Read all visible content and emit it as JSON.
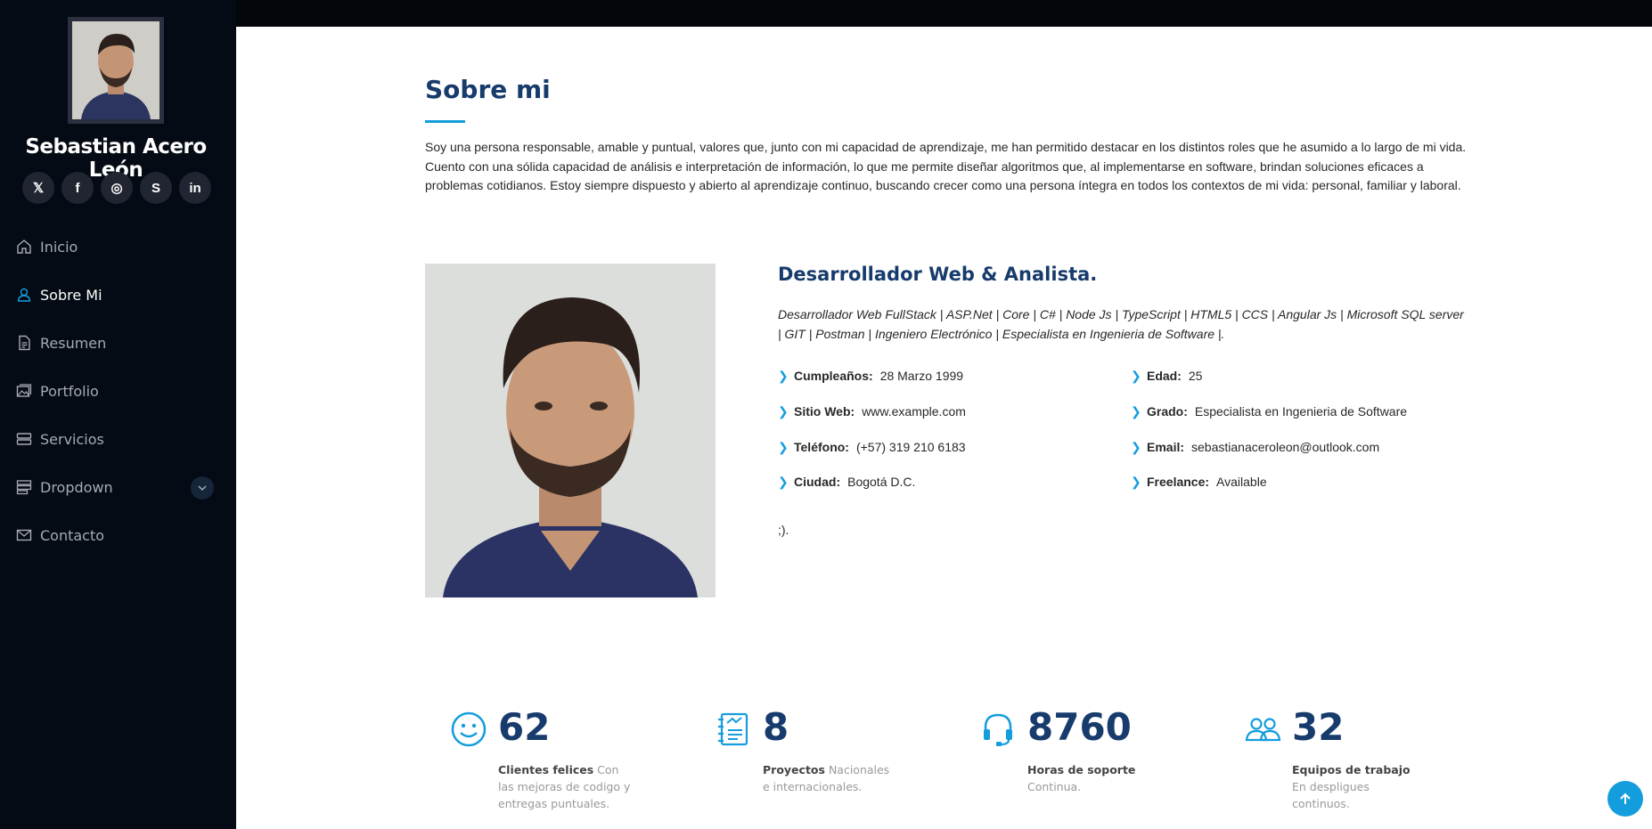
{
  "sidebar": {
    "name": "Sebastian Acero León",
    "social": [
      {
        "icon": "x-twitter-icon",
        "glyph": "𝕏"
      },
      {
        "icon": "facebook-icon",
        "glyph": "f"
      },
      {
        "icon": "instagram-icon",
        "glyph": "◎"
      },
      {
        "icon": "skype-icon",
        "glyph": "S"
      },
      {
        "icon": "linkedin-icon",
        "glyph": "in"
      }
    ],
    "nav": [
      {
        "label": "Inicio",
        "icon": "home-icon",
        "active": false
      },
      {
        "label": "Sobre Mi",
        "icon": "user-icon",
        "active": true
      },
      {
        "label": "Resumen",
        "icon": "file-icon",
        "active": false
      },
      {
        "label": "Portfolio",
        "icon": "images-icon",
        "active": false
      },
      {
        "label": "Servicios",
        "icon": "server-icon",
        "active": false
      },
      {
        "label": "Dropdown",
        "icon": "menu-icon",
        "active": false
      },
      {
        "label": "Contacto",
        "icon": "envelope-icon",
        "active": false
      }
    ]
  },
  "about": {
    "title": "Sobre mi",
    "intro": "Soy una persona responsable, amable y puntual, valores que, junto con mi capacidad de aprendizaje, me han permitido destacar en los distintos roles que he asumido a lo largo de mi vida. Cuento con una sólida capacidad de análisis e interpretación de información, lo que me permite diseñar algoritmos que, al implementarse en software, brindan soluciones eficaces a problemas cotidianos. Estoy siempre dispuesto y abierto al aprendizaje continuo, buscando crecer como una persona íntegra en todos los contextos de mi vida: personal, familiar y laboral.",
    "role": "Desarrollador Web & Analista.",
    "skills": "Desarrollador Web FullStack | ASP.Net | Core | C# | Node Js | TypeScript | HTML5 | CCS | Angular Js | Microsoft SQL server | GIT | Postman | Ingeniero Electrónico | Especialista en Ingenieria de Software |.",
    "details_left": [
      {
        "label": "Cumpleaños:",
        "value": "28 Marzo 1999"
      },
      {
        "label": "Sitio Web:",
        "value": "www.example.com"
      },
      {
        "label": "Teléfono:",
        "value": "(+57) 319 210 6183"
      },
      {
        "label": "Ciudad:",
        "value": "Bogotá D.C."
      }
    ],
    "details_right": [
      {
        "label": "Edad:",
        "value": "25"
      },
      {
        "label": "Grado:",
        "value": "Especialista en Ingenieria de Software"
      },
      {
        "label": "Email:",
        "value": "sebastianaceroleon@outlook.com"
      },
      {
        "label": "Freelance:",
        "value": "Available"
      }
    ],
    "closing": ";)."
  },
  "stats": [
    {
      "number": "62",
      "bold": "Clientes felices",
      "text": "Con las mejoras de codigo y entregas puntuales.",
      "icon": "smile-icon"
    },
    {
      "number": "8",
      "bold": "Proyectos",
      "text": "Nacionales e internacionales.",
      "icon": "journal-richtext-icon"
    },
    {
      "number": "8760",
      "bold": "Horas de soporte",
      "text": "Continua.",
      "icon": "headset-icon"
    },
    {
      "number": "32",
      "bold": "Equipos de trabajo",
      "text": "En despligues continuos.",
      "icon": "people-icon"
    }
  ],
  "colors": {
    "accent": "#149ddd",
    "sidebar": "#040b14",
    "heading": "#173b6c"
  }
}
